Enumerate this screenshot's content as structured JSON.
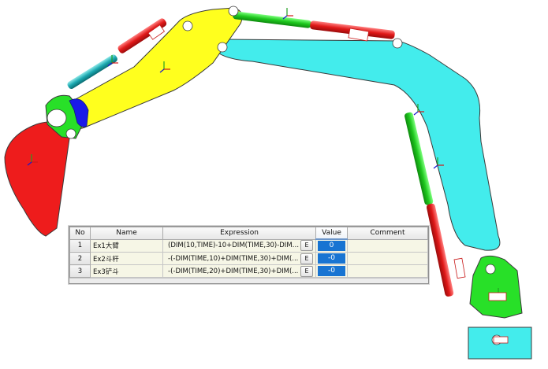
{
  "table": {
    "columns": [
      "No",
      "Name",
      "Expression",
      "Value",
      "Comment"
    ],
    "rows": [
      {
        "no": "1",
        "name": "Ex1大臂",
        "expression": "(DIM(10,TIME)-10+DIM(TIME,30)-DIM(...",
        "button": "E",
        "value": "0",
        "comment": ""
      },
      {
        "no": "2",
        "name": "Ex2斗杆",
        "expression": "-(-DIM(TIME,10)+DIM(TIME,30)+DIM(...",
        "button": "E",
        "value": "-0",
        "comment": ""
      },
      {
        "no": "3",
        "name": "Ex3铲斗",
        "expression": "-(-DIM(TIME,20)+DIM(TIME,30)+DIM(...",
        "button": "E",
        "value": "-0",
        "comment": ""
      }
    ]
  },
  "model": {
    "colors": {
      "bucket": "#ee1c1c",
      "boom": "#ffff1e",
      "arm": "#43ecec",
      "link": "#28e028",
      "cylinder_red": "#e81a1a",
      "cylinder_green": "#22d022",
      "cylinder_blue": "#1a1ae8",
      "base": "#3fd6d6",
      "outline": "#3a3a3a"
    },
    "icons": [
      "joint-marker-icon",
      "coordinate-axes-icon",
      "cylinder-label-icon"
    ]
  }
}
